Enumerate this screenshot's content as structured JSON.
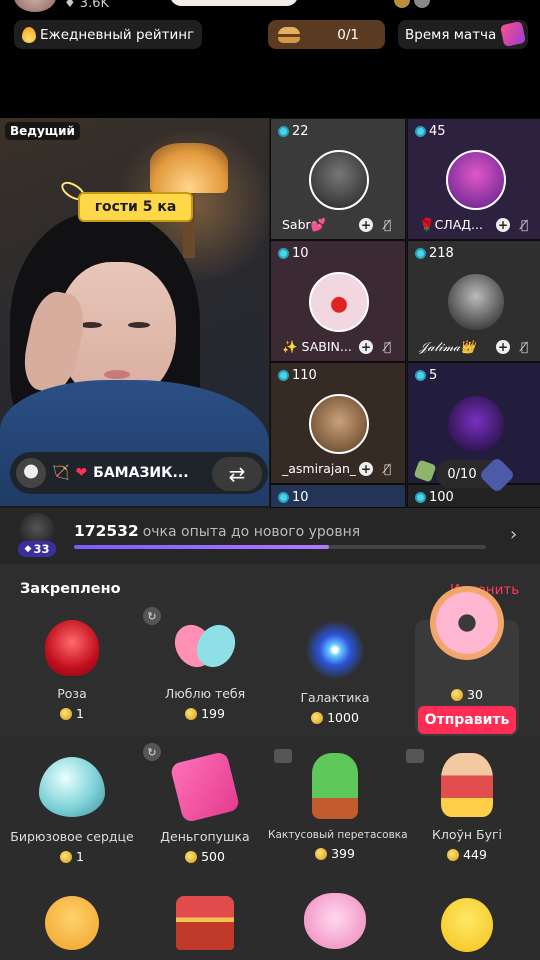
{
  "top": {
    "viewer_count": "3.6K"
  },
  "chips": {
    "daily_rating": "Ежедневный рейтинг",
    "match_progress": "0/1",
    "match_time": "Время матча"
  },
  "host": {
    "label": "Ведущий",
    "guest_tag": "гости 5 ка",
    "name": "БАМАЗИК...",
    "swap": "⇄"
  },
  "guests": [
    {
      "count": "22",
      "name": "Sabr💕",
      "bg": "#3a3a3a"
    },
    {
      "count": "45",
      "name": "🌹СЛАД...",
      "bg": "#2d2140"
    },
    {
      "count": "10",
      "name": "",
      "bg": "#3b2a33"
    },
    {
      "count": "218",
      "name": "",
      "bg": "#2f2f2f"
    },
    {
      "count": "110",
      "name": "_asmirajan_",
      "bg": "#352a24"
    },
    {
      "count": "5",
      "name": "",
      "bg": "#221d3d"
    },
    {
      "count": "10",
      "name": "",
      "bg": "#233457"
    },
    {
      "count": "100",
      "name": "",
      "bg": "#232323"
    }
  ],
  "guest_names_extra": {
    "g3": "✨ SABIN...",
    "g4": "𝒥𝒶𝓁𝒾𝓂𝒶👑"
  },
  "seat_progress": "0/10",
  "level": {
    "points": "172532",
    "text": "очка опыта до нового уровня",
    "badge": "33",
    "fill_fraction": 0.62
  },
  "pinned": {
    "title": "Закреплено",
    "edit": "Изменить"
  },
  "pinned_gifts": [
    {
      "name": "Роза",
      "price": "1"
    },
    {
      "name": "Люблю тебя",
      "price": "199"
    },
    {
      "name": "Галактика",
      "price": "1000"
    }
  ],
  "featured_gift": {
    "price": "30",
    "send": "Отправить"
  },
  "gifts": [
    {
      "name": "Бирюзовое сердце",
      "price": "1"
    },
    {
      "name": "Деньгопушка",
      "price": "500"
    },
    {
      "name": "Кактусовый перетасовка",
      "price": "399"
    },
    {
      "name": "Клоўн Бугі",
      "price": "449"
    }
  ]
}
